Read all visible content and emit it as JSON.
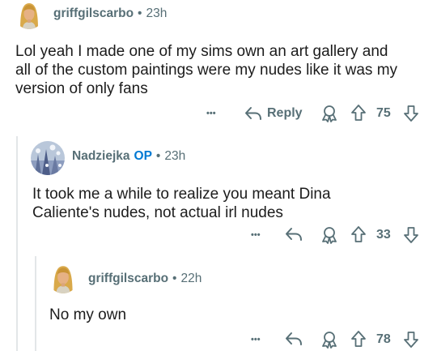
{
  "comments": [
    {
      "username": "griffgilscarbo",
      "is_op": false,
      "time": "23h",
      "body_lines": [
        "Lol yeah I made one of my sims own an art gallery and",
        "all of the custom paintings were my nudes like it was my",
        "version of only fans"
      ],
      "more_label": "•••",
      "reply_label": "Reply",
      "votes": "75"
    },
    {
      "username": "Nadziejka",
      "op_label": "OP",
      "time": "23h",
      "body_lines": [
        "It took me a while to realize you meant Dina",
        "Caliente's nudes, not actual irl nudes"
      ],
      "more_label": "•••",
      "votes": "33"
    },
    {
      "username": "griffgilscarbo",
      "time": "22h",
      "body_lines": [
        "No my own"
      ],
      "more_label": "•••",
      "votes": "78"
    }
  ],
  "separator": "•",
  "icons": [
    "sims-avatar-icon",
    "snow-avatar-icon",
    "reply-arrow-icon",
    "award-icon",
    "upvote-icon",
    "downvote-icon"
  ],
  "colors": {
    "meta": "#576f76",
    "op": "#0079d3",
    "text": "#1c1c1c",
    "thread_line": "#e3e6e8"
  }
}
